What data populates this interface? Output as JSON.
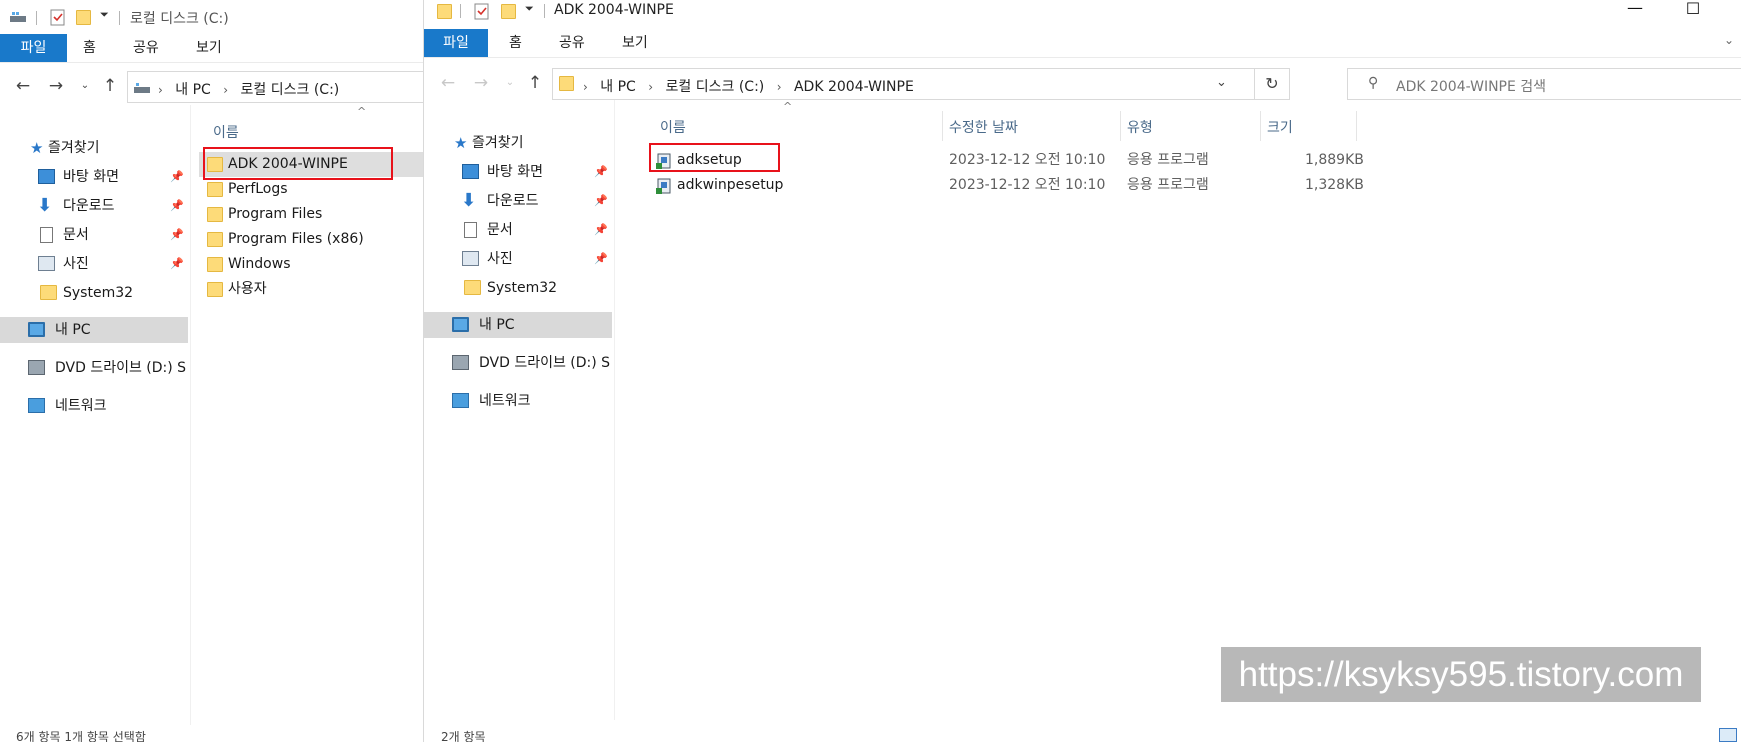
{
  "left_window": {
    "title": "로컬 디스크 (C:)",
    "ribbon_tabs": [
      "파일",
      "홈",
      "공유",
      "보기"
    ],
    "breadcrumb": [
      "내 PC",
      "로컬 디스크 (C:)"
    ],
    "nav": {
      "quick_access": "즐겨찾기",
      "items": [
        {
          "label": "바탕 화면",
          "icon": "desktop-icon",
          "pinned": true
        },
        {
          "label": "다운로드",
          "icon": "download-icon",
          "pinned": true
        },
        {
          "label": "문서",
          "icon": "document-icon",
          "pinned": true
        },
        {
          "label": "사진",
          "icon": "picture-icon",
          "pinned": true
        },
        {
          "label": "System32",
          "icon": "folder-icon",
          "pinned": false
        }
      ],
      "this_pc": "내 PC",
      "dvd": "DVD 드라이브 (D:) S",
      "network": "네트워크"
    },
    "column_name": "이름",
    "files": [
      "ADK 2004-WINPE",
      "PerfLogs",
      "Program Files",
      "Program Files (x86)",
      "Windows",
      "사용자"
    ],
    "status": "6개 항목     1개 항목 선택함"
  },
  "right_window": {
    "title": "ADK 2004-WINPE",
    "ribbon_tabs": [
      "파일",
      "홈",
      "공유",
      "보기"
    ],
    "breadcrumb": [
      "내 PC",
      "로컬 디스크 (C:)",
      "ADK 2004-WINPE"
    ],
    "search_placeholder": "ADK 2004-WINPE 검색",
    "nav": {
      "quick_access": "즐겨찾기",
      "items": [
        {
          "label": "바탕 화면",
          "icon": "desktop-icon",
          "pinned": true
        },
        {
          "label": "다운로드",
          "icon": "download-icon",
          "pinned": true
        },
        {
          "label": "문서",
          "icon": "document-icon",
          "pinned": true
        },
        {
          "label": "사진",
          "icon": "picture-icon",
          "pinned": true
        },
        {
          "label": "System32",
          "icon": "folder-icon",
          "pinned": false
        }
      ],
      "this_pc": "내 PC",
      "dvd": "DVD 드라이브 (D:) S",
      "network": "네트워크"
    },
    "columns": {
      "name": "이름",
      "date": "수정한 날짜",
      "type": "유형",
      "size": "크기"
    },
    "files": [
      {
        "name": "adksetup",
        "date": "2023-12-12 오전 10:10",
        "type": "응용 프로그램",
        "size": "1,889KB"
      },
      {
        "name": "adkwinpesetup",
        "date": "2023-12-12 오전 10:10",
        "type": "응용 프로그램",
        "size": "1,328KB"
      }
    ],
    "status": "2개 항목"
  },
  "watermark": "https://ksyksy595.tistory.com",
  "colors": {
    "ribbon_file_tab": "#1979ca",
    "highlight": "#e8121b",
    "selection": "#d9d9d9"
  }
}
